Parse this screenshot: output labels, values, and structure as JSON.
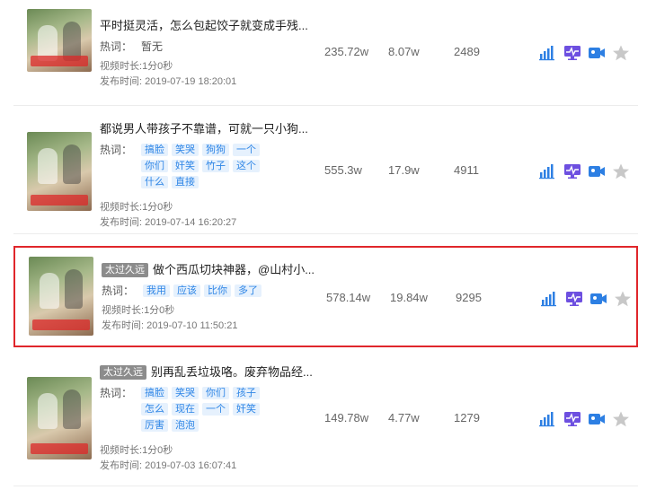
{
  "labels": {
    "keywords": "热词：",
    "duration": "视频时长:",
    "publish": "发布时间:"
  },
  "colors": {
    "tag_bg": "#e6f1fd",
    "tag_text": "#2f86e6",
    "badge_bg": "#8c8c8c",
    "selected_border": "#e0262b",
    "icon_blue": "#2d7fe3",
    "icon_purple": "#6d4fe0",
    "icon_star": "#c8c8c8"
  },
  "videos": [
    {
      "badge": "",
      "title": "平时挺灵活，怎么包起饺子就变成手残...",
      "keywords": [],
      "keywords_none": "暂无",
      "duration": "1分0秒",
      "publish_time": "2019-07-19 18:20:01",
      "plays": "235.72w",
      "likes": "8.07w",
      "comments": "2489",
      "selected": false
    },
    {
      "badge": "",
      "title": "都说男人带孩子不靠谱，可就一只小狗...",
      "keywords": [
        "搞脸",
        "笑哭",
        "狗狗",
        "一个",
        "你们",
        "奸笑",
        "竹子",
        "这个",
        "什么",
        "直接"
      ],
      "keywords_none": "",
      "duration": "1分0秒",
      "publish_time": "2019-07-14 16:20:27",
      "plays": "555.3w",
      "likes": "17.9w",
      "comments": "4911",
      "selected": false
    },
    {
      "badge": "太过久远",
      "title": "做个西瓜切块神器，@山村小...",
      "keywords": [
        "我用",
        "应该",
        "比你",
        "多了"
      ],
      "keywords_none": "",
      "duration": "1分0秒",
      "publish_time": "2019-07-10 11:50:21",
      "plays": "578.14w",
      "likes": "19.84w",
      "comments": "9295",
      "selected": true
    },
    {
      "badge": "太过久远",
      "title": "别再乱丢垃圾咯。废弃物品经...",
      "keywords": [
        "搞脸",
        "笑哭",
        "你们",
        "孩子",
        "怎么",
        "现在",
        "一个",
        "奸笑",
        "厉害",
        "泡泡"
      ],
      "keywords_none": "",
      "duration": "1分0秒",
      "publish_time": "2019-07-03 16:07:41",
      "plays": "149.78w",
      "likes": "4.77w",
      "comments": "1279",
      "selected": false
    }
  ],
  "action_icons": [
    "bar-chart-icon",
    "monitor-pulse-icon",
    "video-camera-icon",
    "star-icon"
  ]
}
